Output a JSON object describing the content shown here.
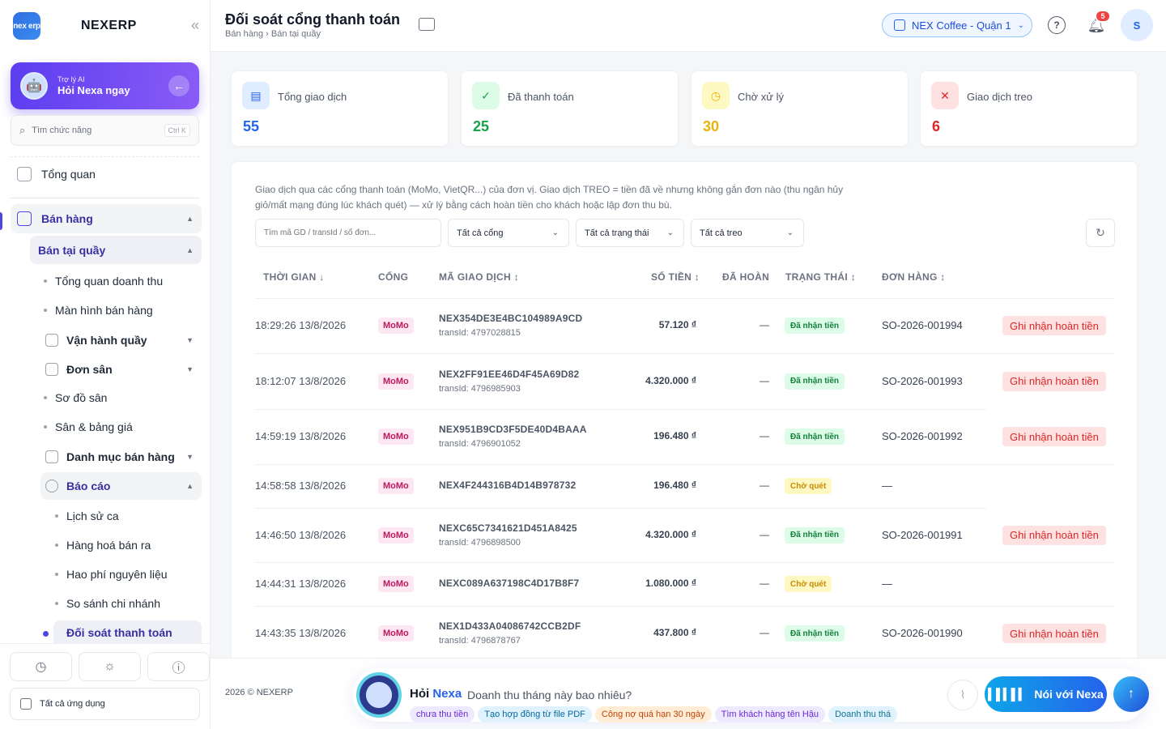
{
  "brand": {
    "logo_text": "nex erp",
    "name": "NEXERP"
  },
  "ai_card": {
    "subtitle": "Trợ lý AI",
    "title": "Hỏi Nexa ngay"
  },
  "side_search": {
    "placeholder": "Tìm chức năng",
    "shortcut": "Ctrl K"
  },
  "sidebar": {
    "overview": "Tổng quan",
    "sales": "Bán hàng",
    "pos": "Bán tại quầy",
    "items": {
      "revenue_overview": "Tổng quan doanh thu",
      "sales_screen": "Màn hình bán hàng",
      "counter_ops": "Vận hành quầy",
      "court_orders": "Đơn sân",
      "court_map": "Sơ đồ sân",
      "court_prices": "Sân & bảng giá",
      "catalog": "Danh mục bán hàng",
      "reports": "Báo cáo",
      "shift_history": "Lịch sử ca",
      "goods_sold": "Hàng hoá bán ra",
      "material_waste": "Hao phí nguyên liệu",
      "branch_compare": "So sánh chi nhánh",
      "payment_recon": "Đối soát thanh toán"
    },
    "all_apps": "Tất cả ứng dụng"
  },
  "header": {
    "title": "Đối soát cổng thanh toán",
    "breadcrumb": "Bán hàng › Bán tại quầy",
    "store": "NEX Coffee - Quận 1",
    "notification_count": "5",
    "user_initial": "S"
  },
  "stats": [
    {
      "label": "Tổng giao dịch",
      "value": "55",
      "color": "#2563eb",
      "bg": "#e0ecff",
      "icon": "wallet-icon"
    },
    {
      "label": "Đã thanh toán",
      "value": "25",
      "color": "#16a34a",
      "bg": "#dcfce7",
      "icon": "check-circle-icon"
    },
    {
      "label": "Chờ xử lý",
      "value": "30",
      "color": "#eab308",
      "bg": "#fef9c3",
      "icon": "clock-icon"
    },
    {
      "label": "Giao dịch treo",
      "value": "6",
      "color": "#dc2626",
      "bg": "#fee2e2",
      "icon": "x-circle-icon"
    }
  ],
  "panel": {
    "description": "Giao dịch qua các cổng thanh toán (MoMo, VietQR...) của đơn vị. Giao dịch TREO = tiền đã về nhưng không gắn đơn nào (thu ngân hủy giỏ/mất mạng đúng lúc khách quét) — xử lý bằng cách hoàn tiền cho khách hoặc lập đơn thu bù.",
    "search_placeholder": "Tìm mã GD / transId / số đơn...",
    "filter_gateway": "Tất cả cổng",
    "filter_status": "Tất cả trạng thái",
    "filter_pending": "Tất cả treo"
  },
  "table": {
    "headers": [
      "THỜI GIAN ↓",
      "CỔNG",
      "MÃ GIAO DỊCH ↕",
      "SỐ TIỀN ↕",
      "ĐÃ HOÀN",
      "TRẠNG THÁI ↕",
      "ĐƠN HÀNG ↕"
    ],
    "rows": [
      {
        "time": "18:29:26 13/8/2026",
        "gateway": "MoMo",
        "code": "NEX354DE3E4BC104989A9CD",
        "trans": "transId: 4797028815",
        "amount": "57.120 ₫",
        "refunded": "—",
        "status": "Đã nhận tiền",
        "order": "SO-2026-001994",
        "action": "Ghi nhận hoàn tiền"
      },
      {
        "time": "18:12:07 13/8/2026",
        "gateway": "MoMo",
        "code": "NEX2FF91EE46D4F45A69D82",
        "trans": "transId: 4796985903",
        "amount": "4.320.000 ₫",
        "refunded": "—",
        "status": "Đã nhận tiền",
        "order": "SO-2026-001993",
        "action": "Ghi nhận hoàn tiền"
      },
      {
        "time": "14:59:19 13/8/2026",
        "gateway": "MoMo",
        "code": "NEX951B9CD3F5DE40D4BAAA",
        "trans": "transId: 4796901052",
        "amount": "196.480 ₫",
        "refunded": "—",
        "status": "Đã nhận tiền",
        "order": "SO-2026-001992",
        "action": "Ghi nhận hoàn tiền"
      },
      {
        "time": "14:58:58 13/8/2026",
        "gateway": "MoMo",
        "code": "NEX4F244316B4D14B978732",
        "trans": "",
        "amount": "196.480 ₫",
        "refunded": "—",
        "status": "Chờ quét",
        "order": "—",
        "action": ""
      },
      {
        "time": "14:46:50 13/8/2026",
        "gateway": "MoMo",
        "code": "NEXC65C7341621D451A8425",
        "trans": "transId: 4796898500",
        "amount": "4.320.000 ₫",
        "refunded": "—",
        "status": "Đã nhận tiền",
        "order": "SO-2026-001991",
        "action": "Ghi nhận hoàn tiền"
      },
      {
        "time": "14:44:31 13/8/2026",
        "gateway": "MoMo",
        "code": "NEXC089A637198C4D17B8F7",
        "trans": "",
        "amount": "1.080.000 ₫",
        "refunded": "—",
        "status": "Chờ quét",
        "order": "—",
        "action": ""
      },
      {
        "time": "14:43:35 13/8/2026",
        "gateway": "MoMo",
        "code": "NEX1D433A04086742CCB2DF",
        "trans": "transId: 4796878767",
        "amount": "437.800 ₫",
        "refunded": "—",
        "status": "Đã nhận tiền",
        "order": "SO-2026-001990",
        "action": "Ghi nhận hoàn tiền"
      }
    ]
  },
  "footer": {
    "copyright": "2026 © NEXERP",
    "assist_prefix": "Hỏi",
    "assist_name": "Nexa",
    "assist_question": "Doanh thu tháng này bao nhiêu?",
    "chips": [
      "chưa thu tiền",
      "Tạo hợp đồng từ file PDF",
      "Công nợ quá hạn 30 ngày",
      "Tìm khách hàng tên Hậu",
      "Doanh thu thá"
    ],
    "talk_label": "Nói với Nexa"
  }
}
